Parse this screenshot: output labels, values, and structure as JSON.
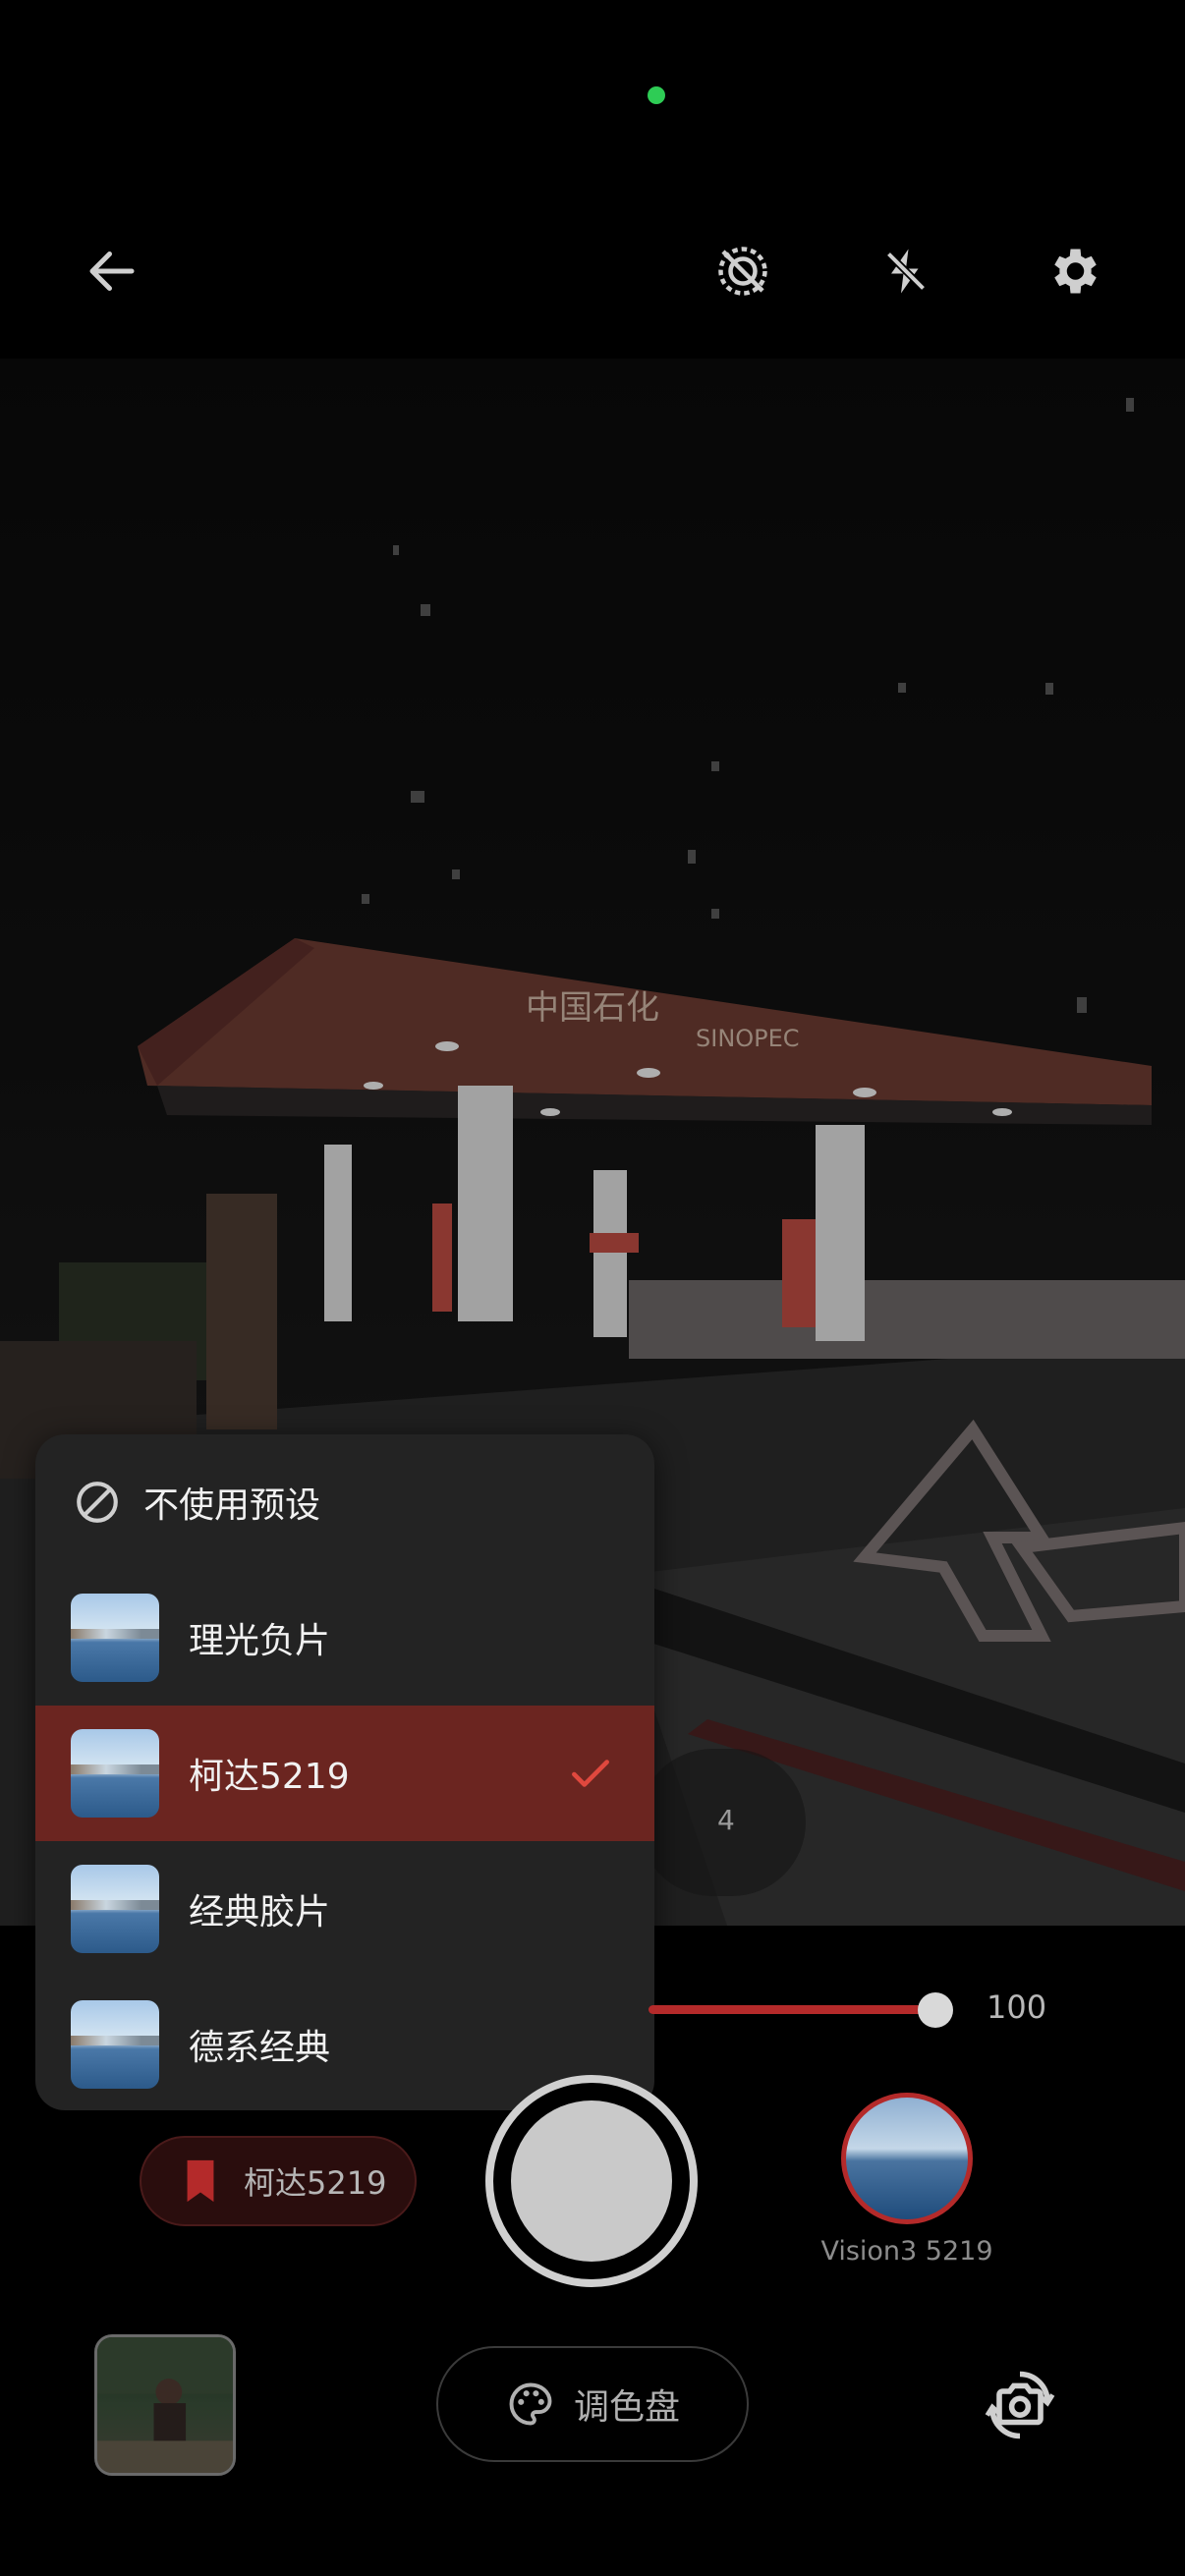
{
  "preset_menu": {
    "none_label": "不使用预设",
    "items": [
      {
        "label": "理光负片",
        "selected": false
      },
      {
        "label": "柯达5219",
        "selected": true
      },
      {
        "label": "经典胶片",
        "selected": false
      },
      {
        "label": "德系经典",
        "selected": false
      }
    ]
  },
  "intensity": {
    "value": "100",
    "fraction": 1.0
  },
  "counter": "4",
  "active_preset": {
    "label": "柯达5219"
  },
  "film_stock": {
    "label": "Vision3 5219"
  },
  "palette_button": {
    "label": "调色盘"
  },
  "viewfinder_signs": {
    "brand_cn": "中国石化",
    "brand_en": "SINOPEC"
  },
  "colors": {
    "accent": "#b42a2a",
    "selected_row": "#6b2520",
    "status_dot": "#2ecc55"
  }
}
